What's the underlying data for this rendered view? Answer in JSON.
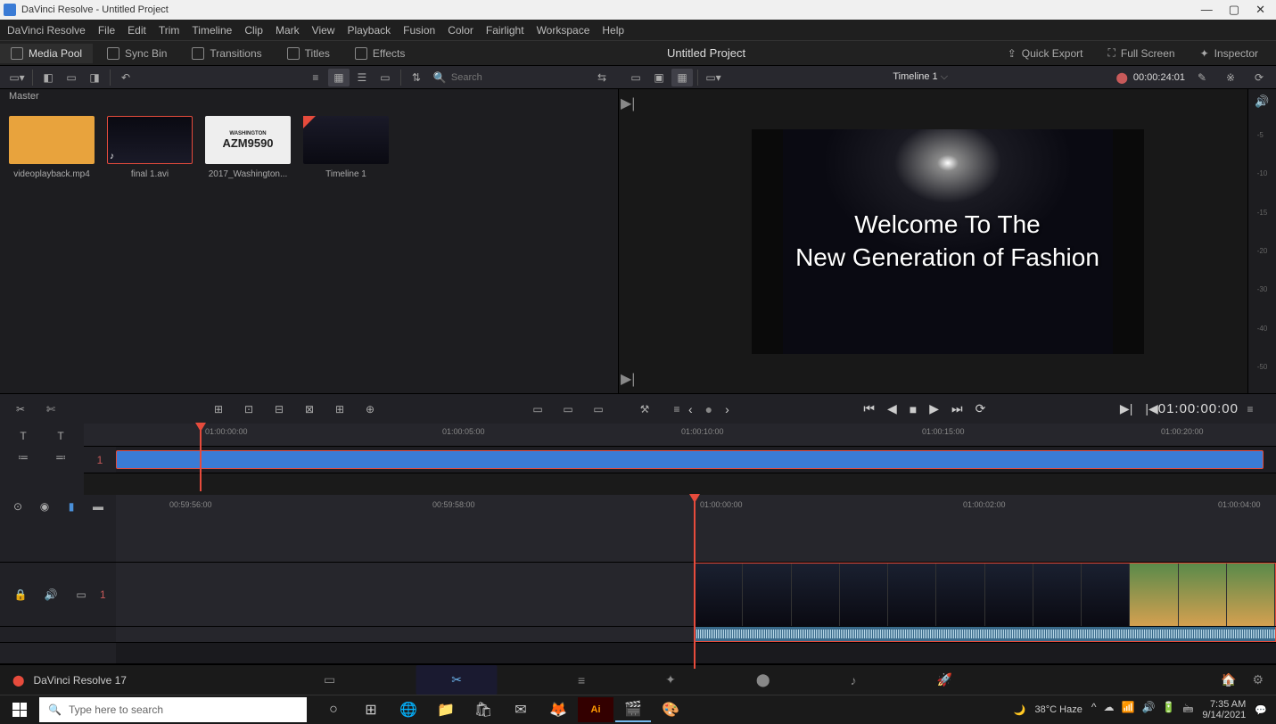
{
  "window": {
    "app": "DaVinci Resolve",
    "title": "DaVinci Resolve - Untitled Project"
  },
  "menus": [
    "DaVinci Resolve",
    "File",
    "Edit",
    "Trim",
    "Timeline",
    "Clip",
    "Mark",
    "View",
    "Playback",
    "Fusion",
    "Color",
    "Fairlight",
    "Workspace",
    "Help"
  ],
  "header": {
    "tabs": [
      {
        "label": "Media Pool",
        "active": true
      },
      {
        "label": "Sync Bin",
        "active": false
      },
      {
        "label": "Transitions",
        "active": false
      },
      {
        "label": "Titles",
        "active": false
      },
      {
        "label": "Effects",
        "active": false
      }
    ],
    "project": "Untitled Project",
    "right": [
      {
        "label": "Quick Export"
      },
      {
        "label": "Full Screen"
      },
      {
        "label": "Inspector"
      }
    ]
  },
  "search": {
    "placeholder": "Search"
  },
  "mediaPool": {
    "breadcrumb": "Master",
    "items": [
      {
        "name": "videoplayback.mp4"
      },
      {
        "name": "final 1.avi"
      },
      {
        "name": "2017_Washington..."
      },
      {
        "name": "Timeline 1"
      }
    ],
    "plate": {
      "top": "WASHINGTON",
      "main": "AZM9590"
    }
  },
  "viewer": {
    "timelineName": "Timeline 1",
    "duration": "00:00:24:01",
    "overlay_line1": "Welcome To The",
    "overlay_line2": "New Generation of Fashion",
    "meter": [
      "-5",
      "-10",
      "-15",
      "-20",
      "-30",
      "-40",
      "-50"
    ]
  },
  "transport": {
    "timecode": "01:00:00:00"
  },
  "miniRuler": {
    "marks": [
      "01:00:00:00",
      "01:00:05:00",
      "01:00:10:00",
      "01:00:15:00",
      "01:00:20:00"
    ],
    "track": "1"
  },
  "detailRuler": {
    "marks": [
      "00:59:56:00",
      "00:59:58:00",
      "01:00:00:00",
      "01:00:02:00",
      "01:00:04:00"
    ],
    "track": "1"
  },
  "footer": {
    "version": "DaVinci Resolve 17"
  },
  "taskbar": {
    "search": "Type here to search",
    "weather": "38°C Haze",
    "time": "7:35 AM",
    "date": "9/14/2021"
  }
}
